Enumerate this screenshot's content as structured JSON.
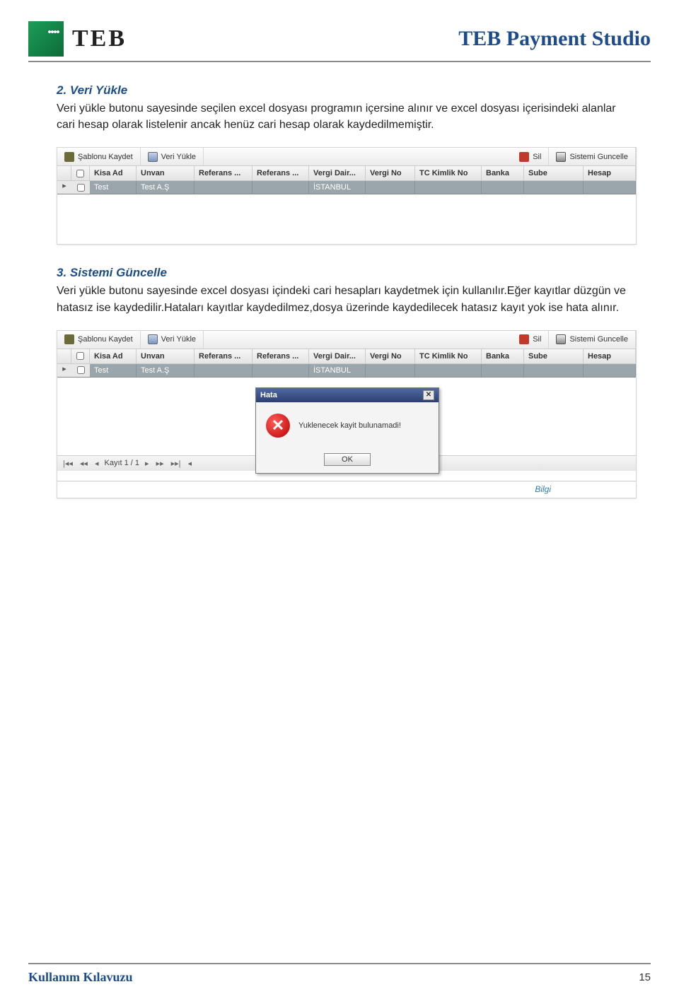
{
  "header": {
    "logo_text": "TEB",
    "doc_title": "TEB Payment Studio"
  },
  "section2": {
    "heading": "2.   Veri Yükle",
    "body": "Veri yükle butonu sayesinde seçilen excel dosyası programın içersine alınır ve excel dosyası içerisindeki alanlar cari hesap olarak listelenir ancak henüz cari hesap olarak kaydedilmemiştir."
  },
  "section3": {
    "heading": "3.   Sistemi Güncelle",
    "body": "Veri yükle butonu sayesinde excel dosyası içindeki cari hesapları kaydetmek için kullanılır.Eğer kayıtlar düzgün ve hatasız ise kaydedilir.Hataları kayıtlar kaydedilmez,dosya üzerinde kaydedilecek hatasız kayıt yok ise hata alınır."
  },
  "toolbar": {
    "save_template": "Şablonu Kaydet",
    "load_data": "Veri Yükle",
    "delete": "Sil",
    "update_system": "Sistemi Guncelle"
  },
  "columns": {
    "kisa_ad": "Kisa Ad",
    "unvan": "Unvan",
    "ref1": "Referans ...",
    "ref2": "Referans ...",
    "vergi_dair": "Vergi Dair...",
    "vergi_no": "Vergi No",
    "tc": "TC Kimlik No",
    "banka": "Banka",
    "sube": "Sube",
    "hesap": "Hesap"
  },
  "row": {
    "kisa_ad": "Test",
    "unvan": "Test A.Ş",
    "vergi_dair": "İSTANBUL"
  },
  "pager": {
    "text": "Kayıt 1 / 1",
    "first": "|◂◂",
    "prev2": "◂◂",
    "prev": "◂",
    "next": "▸",
    "next2": "▸▸",
    "last": "▸▸|",
    "end": "◂"
  },
  "dialog": {
    "title": "Hata",
    "message": "Yuklenecek kayit bulunamadi!",
    "ok": "OK"
  },
  "bilgi": "Bilgi",
  "footer": {
    "title": "Kullanım Kılavuzu",
    "page": "15"
  }
}
